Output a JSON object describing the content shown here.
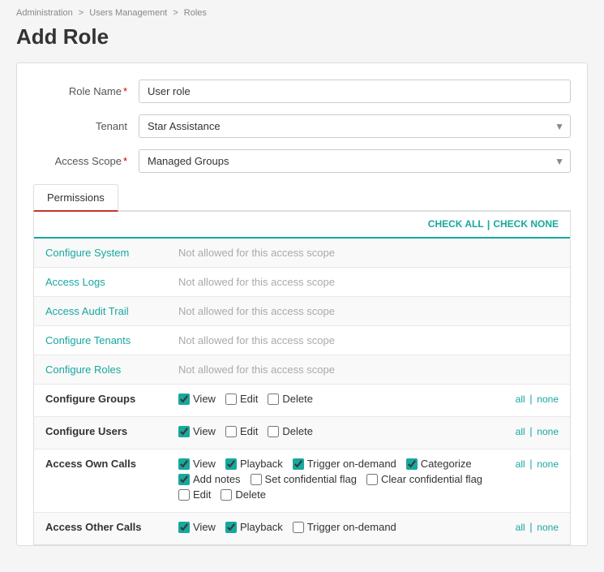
{
  "breadcrumb": {
    "parts": [
      "Administration",
      "Users Management",
      "Roles"
    ]
  },
  "page_title": "Add Role",
  "form": {
    "role_name_label": "Role Name",
    "role_name_value": "User role",
    "tenant_label": "Tenant",
    "tenant_value": "Star Assistance",
    "access_scope_label": "Access Scope",
    "access_scope_value": "Managed Groups"
  },
  "tabs": [
    {
      "label": "Permissions",
      "active": true
    }
  ],
  "check_all": "CHECK ALL",
  "check_none": "CHECK NONE",
  "separator": "|",
  "permissions": [
    {
      "name": "Configure System",
      "type": "disabled",
      "not_allowed_text": "Not allowed for this access scope"
    },
    {
      "name": "Access Logs",
      "type": "disabled",
      "not_allowed_text": "Not allowed for this access scope"
    },
    {
      "name": "Access Audit Trail",
      "type": "disabled",
      "not_allowed_text": "Not allowed for this access scope"
    },
    {
      "name": "Configure Tenants",
      "type": "disabled",
      "not_allowed_text": "Not allowed for this access scope"
    },
    {
      "name": "Configure Roles",
      "type": "disabled",
      "not_allowed_text": "Not allowed for this access scope"
    },
    {
      "name": "Configure Groups",
      "type": "enabled",
      "controls": [
        {
          "id": "cg_view",
          "label": "View",
          "checked": true
        },
        {
          "id": "cg_edit",
          "label": "Edit",
          "checked": false
        },
        {
          "id": "cg_delete",
          "label": "Delete",
          "checked": false
        }
      ],
      "has_all_none": true
    },
    {
      "name": "Configure Users",
      "type": "enabled",
      "controls": [
        {
          "id": "cu_view",
          "label": "View",
          "checked": true
        },
        {
          "id": "cu_edit",
          "label": "Edit",
          "checked": false
        },
        {
          "id": "cu_delete",
          "label": "Delete",
          "checked": false
        }
      ],
      "has_all_none": true
    },
    {
      "name": "Access Own Calls",
      "type": "enabled",
      "controls": [
        {
          "id": "aoc_view",
          "label": "View",
          "checked": true
        },
        {
          "id": "aoc_playback",
          "label": "Playback",
          "checked": true
        },
        {
          "id": "aoc_trigger",
          "label": "Trigger on-demand",
          "checked": true
        },
        {
          "id": "aoc_categorize",
          "label": "Categorize",
          "checked": true
        },
        {
          "id": "aoc_addnotes",
          "label": "Add notes",
          "checked": true
        },
        {
          "id": "aoc_setconf",
          "label": "Set confidential flag",
          "checked": false
        },
        {
          "id": "aoc_clearconf",
          "label": "Clear confidential flag",
          "checked": false
        },
        {
          "id": "aoc_edit",
          "label": "Edit",
          "checked": false
        },
        {
          "id": "aoc_delete",
          "label": "Delete",
          "checked": false
        }
      ],
      "has_all_none": true
    },
    {
      "name": "Access Other Calls",
      "type": "enabled",
      "controls": [
        {
          "id": "aothc_view",
          "label": "View",
          "checked": true
        },
        {
          "id": "aothc_playback",
          "label": "Playback",
          "checked": true
        },
        {
          "id": "aothc_trigger",
          "label": "Trigger on-demand",
          "checked": false
        }
      ],
      "has_all_none": true
    }
  ]
}
